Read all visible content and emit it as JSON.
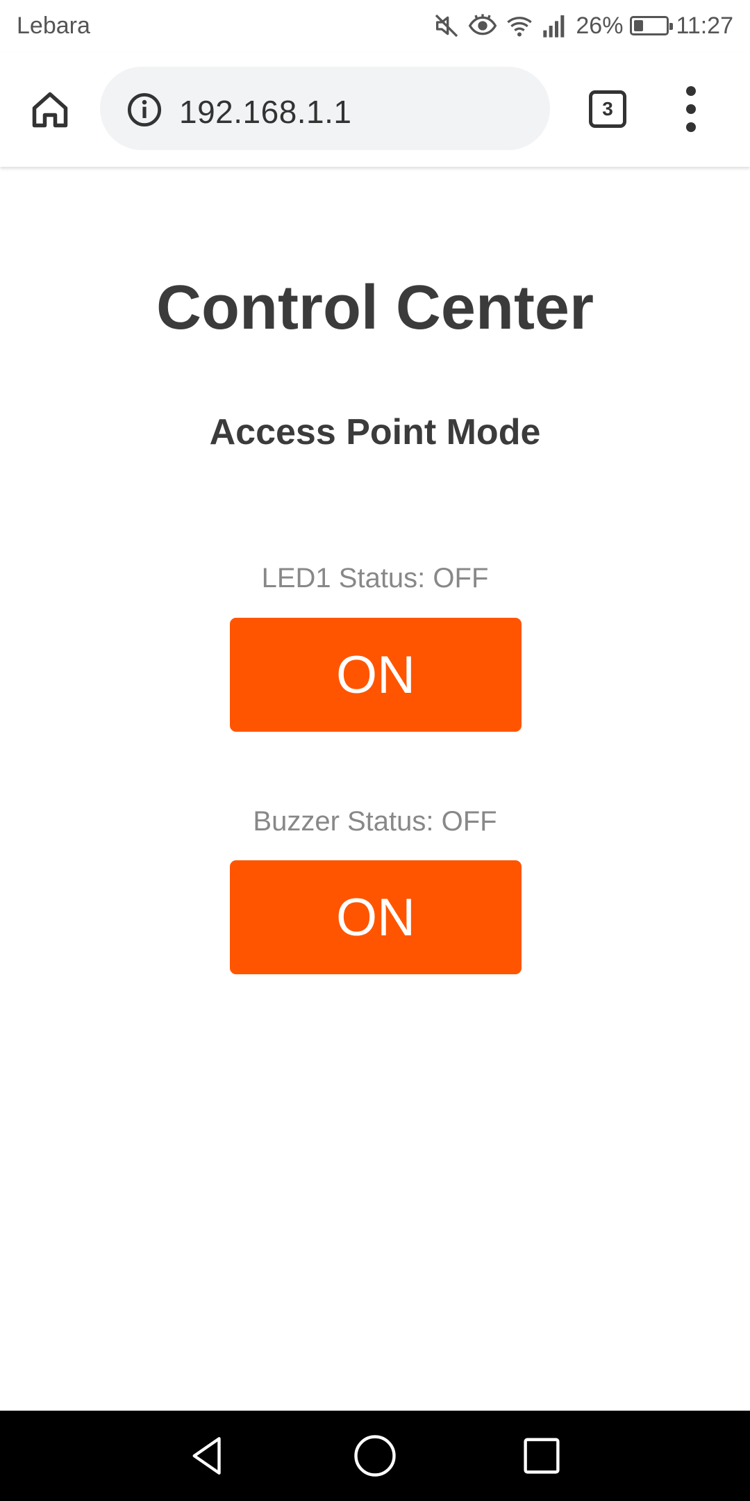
{
  "status_bar": {
    "carrier": "Lebara",
    "battery_percent": "26%",
    "battery_level": 0.26,
    "time": "11:27",
    "icons": [
      "mute-icon",
      "eye-comfort-icon",
      "wifi-icon",
      "signal-icon",
      "battery-icon"
    ]
  },
  "browser": {
    "url": "192.168.1.1",
    "tab_count": "3",
    "icons": [
      "home-icon",
      "info-icon",
      "tabs-icon",
      "more-vert-icon"
    ]
  },
  "page": {
    "title": "Control Center",
    "subtitle": "Access Point Mode",
    "controls": [
      {
        "status": "LED1 Status: OFF",
        "button_label": "ON"
      },
      {
        "status": "Buzzer Status: OFF",
        "button_label": "ON"
      }
    ],
    "accent_color": "#ff5500"
  },
  "nav_bar": {
    "icons": [
      "back-icon",
      "home-circle-icon",
      "recents-icon"
    ]
  }
}
